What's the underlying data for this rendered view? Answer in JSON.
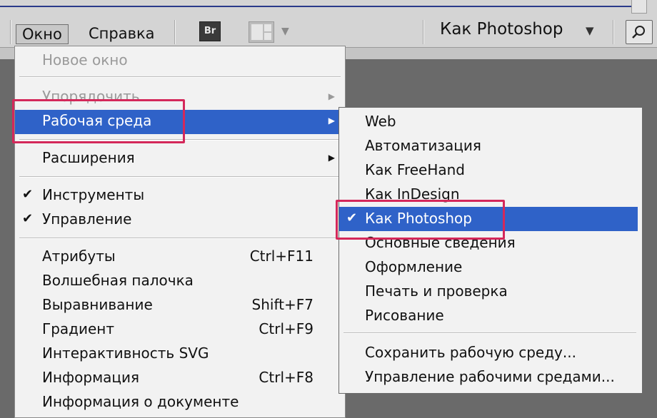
{
  "menubar": {
    "window_label": "Окно",
    "help_label": "Справка",
    "bridge_icon_text": "Br",
    "workspace_label": "Как Photoshop"
  },
  "main_menu": {
    "items": [
      {
        "label": "Новое окно",
        "shortcut": "",
        "disabled": true
      },
      {
        "label": "Упорядочить",
        "shortcut": "",
        "disabled": true,
        "submenu": true
      },
      {
        "label": "Рабочая среда",
        "shortcut": "",
        "selected": true,
        "submenu": true
      },
      {
        "label": "Расширения",
        "shortcut": "",
        "submenu": true
      },
      {
        "label": "Инструменты",
        "shortcut": "",
        "checked": true
      },
      {
        "label": "Управление",
        "shortcut": "",
        "checked": true
      },
      {
        "label": "Атрибуты",
        "shortcut": "Ctrl+F11"
      },
      {
        "label": "Волшебная палочка",
        "shortcut": ""
      },
      {
        "label": "Выравнивание",
        "shortcut": "Shift+F7"
      },
      {
        "label": "Градиент",
        "shortcut": "Ctrl+F9"
      },
      {
        "label": "Интерактивность SVG",
        "shortcut": ""
      },
      {
        "label": "Информация",
        "shortcut": "Ctrl+F8"
      },
      {
        "label": "Информация о документе",
        "shortcut": ""
      }
    ]
  },
  "workspace_submenu": {
    "items": [
      {
        "label": "Web"
      },
      {
        "label": "Автоматизация"
      },
      {
        "label": "Как FreeHand"
      },
      {
        "label": "Как InDesign"
      },
      {
        "label": "Как Photoshop",
        "checked": true,
        "selected": true
      },
      {
        "label": "Основные сведения"
      },
      {
        "label": "Оформление"
      },
      {
        "label": "Печать и проверка"
      },
      {
        "label": "Рисование"
      },
      {
        "label": "Сохранить рабочую среду..."
      },
      {
        "label": "Управление рабочими средами..."
      }
    ]
  },
  "icons": {
    "check": "checkmark-icon",
    "submenu": "triangle-right-icon",
    "search": "search-icon"
  },
  "colors": {
    "selection": "#2f62c8",
    "highlight_box": "#d4285a"
  }
}
